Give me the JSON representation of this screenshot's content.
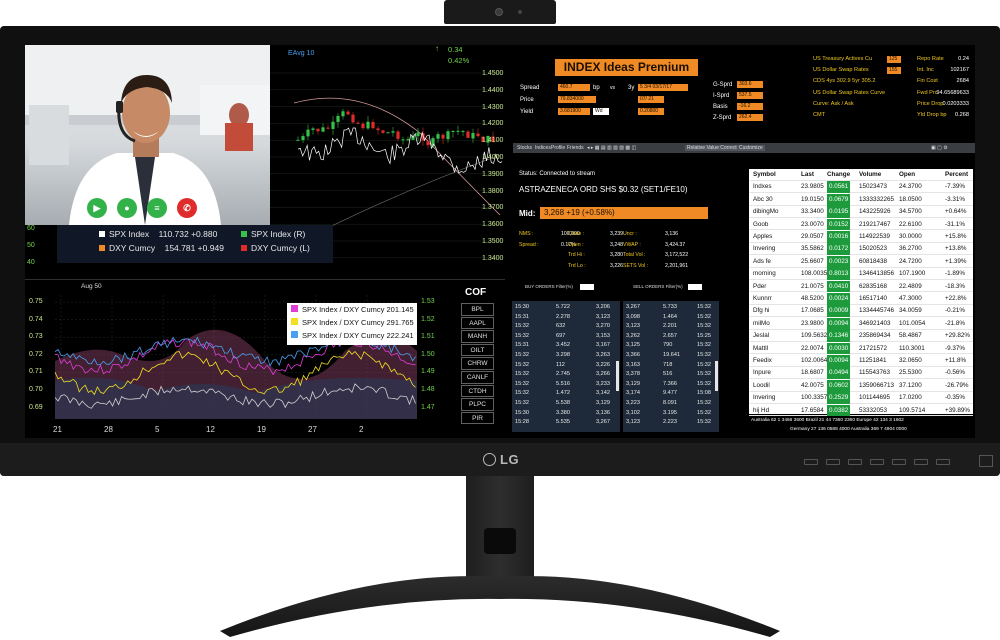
{
  "brand": "LG",
  "video_call": {
    "buttons": [
      {
        "name": "camera",
        "icon": "video-camera-icon"
      },
      {
        "name": "mic",
        "icon": "microphone-icon"
      },
      {
        "name": "chat",
        "icon": "chat-icon"
      },
      {
        "name": "end",
        "icon": "phone-end-icon"
      }
    ]
  },
  "top_chart": {
    "eavg_label": "EAvg 10",
    "change_value": "0.34",
    "change_percent": "0.42%",
    "right_axis_ticks": [
      "1.4500",
      "1.4400",
      "1.4300",
      "1.4200",
      "1.4100",
      "1.4000",
      "1.3900",
      "1.3800",
      "1.3700",
      "1.3600",
      "1.3500",
      "1.3400"
    ],
    "left_axis_ticks": [
      "60",
      "50",
      "40"
    ],
    "legend": [
      {
        "name": "SPX Index",
        "value": "110.732 +0.880",
        "color": "#ffffff"
      },
      {
        "name": "DXY Cumcy",
        "value": "154.781 +0.949",
        "color": "#f08a24"
      },
      {
        "name": "SPX Index (R)",
        "color": "#34c24a"
      },
      {
        "name": "DXY Cumcy (L)",
        "color": "#e02b2b"
      }
    ]
  },
  "bottom_chart": {
    "date_label": "Aug 50",
    "left_axis_ticks": [
      "0.75",
      "0.74",
      "0.73",
      "0.72",
      "0.71",
      "0.70",
      "0.69"
    ],
    "right_axis_ticks": [
      "1.53",
      "1.52",
      "1.51",
      "1.50",
      "1.49",
      "1.48",
      "1.47"
    ],
    "x_ticks": [
      "21",
      "28",
      "5",
      "12",
      "19",
      "27",
      "2"
    ],
    "legend": [
      {
        "name": "SPX Index / DXY Cumcy",
        "value": "201.145",
        "color": "#e03cd8"
      },
      {
        "name": "SPX Index / DXY Cumcy",
        "value": "291.765",
        "color": "#f0e020"
      },
      {
        "name": "SPX Index / DXY Cumcy",
        "value": "222.241",
        "color": "#4aa0f0"
      }
    ]
  },
  "cof": {
    "title": "COF",
    "items": [
      "BPL",
      "AAPL",
      "MANH",
      "OILT",
      "CHRW",
      "CANLF",
      "CTDH",
      "PLPC",
      "PIR"
    ]
  },
  "index_panel": {
    "title": "INDEX  Ideas Premium",
    "left_fields": [
      {
        "label": "Spread",
        "box": "460.7",
        "unit": "bp",
        "unit2": "vs",
        "extra": "3y",
        "extra_val": "5 3/4   03/17/17"
      },
      {
        "label": "Price",
        "box": "79.834000",
        "extra_val": "07/ 21"
      },
      {
        "label": "Yield",
        "box": "3.681900",
        "unit": "Wd",
        "extra_val": "0.20800"
      }
    ],
    "mid_fields": [
      {
        "label": "G-Sprd",
        "box": "303.6"
      },
      {
        "label": "I-Sprd",
        "box": "537.5"
      },
      {
        "label": "Basis",
        "box": "-16.2"
      },
      {
        "label": "Z-Sprd",
        "box": "262.4"
      }
    ],
    "yellow_rows": [
      {
        "label": "US Treasury Actives Cu",
        "box": "125"
      },
      {
        "label": "US Dollar Swap Rates",
        "box": "155"
      },
      {
        "label": "CDS 4ys 302.9    5yr 305.2"
      },
      {
        "label": "US Dollar Swap Rates Curve"
      },
      {
        "label": "Curve: Ask / Ask"
      },
      {
        "label": "CMT"
      }
    ],
    "right_stats": [
      {
        "label": "Repo Rate",
        "value": "0.24"
      },
      {
        "label": "Int. Inc",
        "value": "102167"
      },
      {
        "label": "Fin Cost",
        "value": "2684"
      },
      {
        "label": "Fwd Prc",
        "value": "94.65689633"
      },
      {
        "label": "Price Drop",
        "value": "0.0203333"
      },
      {
        "label": "Yld Drop bp",
        "value": "0.268"
      }
    ]
  },
  "toolbar": {
    "items": [
      "Stocks",
      "Indices",
      "Profile",
      "Friends",
      "",
      "",
      "",
      "",
      "",
      "",
      "",
      "",
      "",
      "Relative Value Correction",
      "Customize"
    ]
  },
  "stock_detail": {
    "status": "Status: Connected to stream",
    "name": "ASTRAZENECA ORD SHS $0.32 (SET1/FE10)",
    "mid_label": "Mid:",
    "mid_value": "3,268  +19 (+0.58%)",
    "stats": [
      {
        "label": "NMS :",
        "value": "100,000"
      },
      {
        "label": "Spread :",
        "value": "0.17%"
      },
      {
        "label": "Close :",
        "value": "3,239"
      },
      {
        "label": "Open :",
        "value": "3,248"
      },
      {
        "label": "Trd Hi :",
        "value": "3,280"
      },
      {
        "label": "Trd Lo :",
        "value": "3,226"
      },
      {
        "label": "Uncr :",
        "value": "3,136"
      },
      {
        "label": "VWAP :",
        "value": "3,424.37"
      },
      {
        "label": "Total Vol :",
        "value": "3,172,522"
      },
      {
        "label": "SETS Vol :",
        "value": "2,201,961"
      }
    ],
    "buy_label": "BUY ORDERS Filter(%)",
    "sell_label": "SELL ORDERS Filter(%)",
    "buy_rows": [
      [
        "15:30",
        "5.722",
        "3,206"
      ],
      [
        "15:31",
        "2.278",
        "3,123"
      ],
      [
        "15:32",
        "632",
        "3,270"
      ],
      [
        "15:32",
        "697",
        "3,153"
      ],
      [
        "15:31",
        "3.452",
        "3,167"
      ],
      [
        "15:32",
        "3.298",
        "3,263"
      ],
      [
        "15:32",
        "112",
        "3,226"
      ],
      [
        "15:32",
        "2.745",
        "3,266"
      ],
      [
        "15:32",
        "5.516",
        "3,233"
      ],
      [
        "15:32",
        "1.472",
        "3,142"
      ],
      [
        "15:32",
        "5.538",
        "3,129"
      ],
      [
        "15:30",
        "3.380",
        "3,136"
      ],
      [
        "15:28",
        "5.535",
        "3,267"
      ]
    ],
    "sell_rows": [
      [
        "3,267",
        "5.733",
        "15:32"
      ],
      [
        "3,098",
        "1.464",
        "15:32"
      ],
      [
        "3,123",
        "2.201",
        "15:32"
      ],
      [
        "3,262",
        "2.657",
        "15:25"
      ],
      [
        "3,125",
        "790",
        "15:32"
      ],
      [
        "3,366",
        "19.641",
        "15:32"
      ],
      [
        "3,163",
        "718",
        "15:32"
      ],
      [
        "3,378",
        "516",
        "15:32"
      ],
      [
        "3,129",
        "7.366",
        "15:32"
      ],
      [
        "3,174",
        "9.477",
        "15:08"
      ],
      [
        "3,223",
        "8.091",
        "15:32"
      ],
      [
        "3,102",
        "3.195",
        "15:32"
      ],
      [
        "3,123",
        "2.223",
        "15:32"
      ]
    ]
  },
  "watchlist": {
    "headers": [
      "Symbol",
      "Last",
      "Change",
      "Volume",
      "Open",
      "Percent"
    ],
    "rows": [
      [
        "Indxes",
        "23.9805",
        "0.0561",
        "15023473",
        "24.3700",
        "-7.39%"
      ],
      [
        "Abc 30",
        "19.0150",
        "0.0679",
        "1333332265",
        "18.0500",
        "-3.31%"
      ],
      [
        "dibingMo",
        "33.3400",
        "0.0195",
        "143225926",
        "34.5700",
        "+0.64%"
      ],
      [
        "Goob",
        "23.0070",
        "0.0152",
        "219217467",
        "22.6100",
        "-31.1%"
      ],
      [
        "Apples",
        "29.0507",
        "0.0016",
        "114922539",
        "30.0000",
        "+15.8%"
      ],
      [
        "Invering",
        "35.5862",
        "0.0172",
        "15020523",
        "36.2700",
        "+13.8%"
      ],
      [
        "Ads fe",
        "25.6607",
        "0.0023",
        "60818438",
        "24.7200",
        "+1.39%"
      ],
      [
        "morning",
        "108.0035",
        "0.8013",
        "1346413856",
        "107.1900",
        "-1.89%"
      ],
      [
        "Pder",
        "21.0075",
        "0.0410",
        "62835168",
        "22.4809",
        "-18.3%"
      ],
      [
        "Kunnrr",
        "48.5200",
        "0.0024",
        "16517140",
        "47.3000",
        "+22.8%"
      ],
      [
        "Dfg hi",
        "17.0685",
        "0.0009",
        "1334445746",
        "34.0059",
        "-0.21%"
      ],
      [
        "milMo",
        "23.9800",
        "0.0094",
        "346921403",
        "101.0054",
        "-21.8%"
      ],
      [
        "Jeslal",
        "109.5632",
        "0.1346",
        "235869434",
        "58.4867",
        "+29.82%"
      ],
      [
        "Mattll",
        "22.0074",
        "0.0030",
        "21721572",
        "110.3001",
        "-9.37%"
      ],
      [
        "Feedix",
        "102.0064",
        "0.0094",
        "11251841",
        "32.0650",
        "+11.8%"
      ],
      [
        "Inpure",
        "18.6807",
        "0.0494",
        "115543763",
        "25.5300",
        "-0.56%"
      ],
      [
        "Loodil",
        "42.0075",
        "0.0602",
        "1359066713",
        "37.1200",
        "-26.79%"
      ],
      [
        "Invering",
        "100.3357",
        "0.2529",
        "101144695",
        "17.0200",
        "-0.35%"
      ],
      [
        "hij Hd",
        "17.6584",
        "0.0382",
        "53332053",
        "109.5714",
        "+39.89%"
      ]
    ],
    "footer_line1": "Australia   62  1  3466  3600      Brazil   21  44  7360  2360       Europe   42  134  3  1602",
    "footer_line2": "Germany   27  136  0588  4000       Australia   369  7  4904  0000"
  }
}
